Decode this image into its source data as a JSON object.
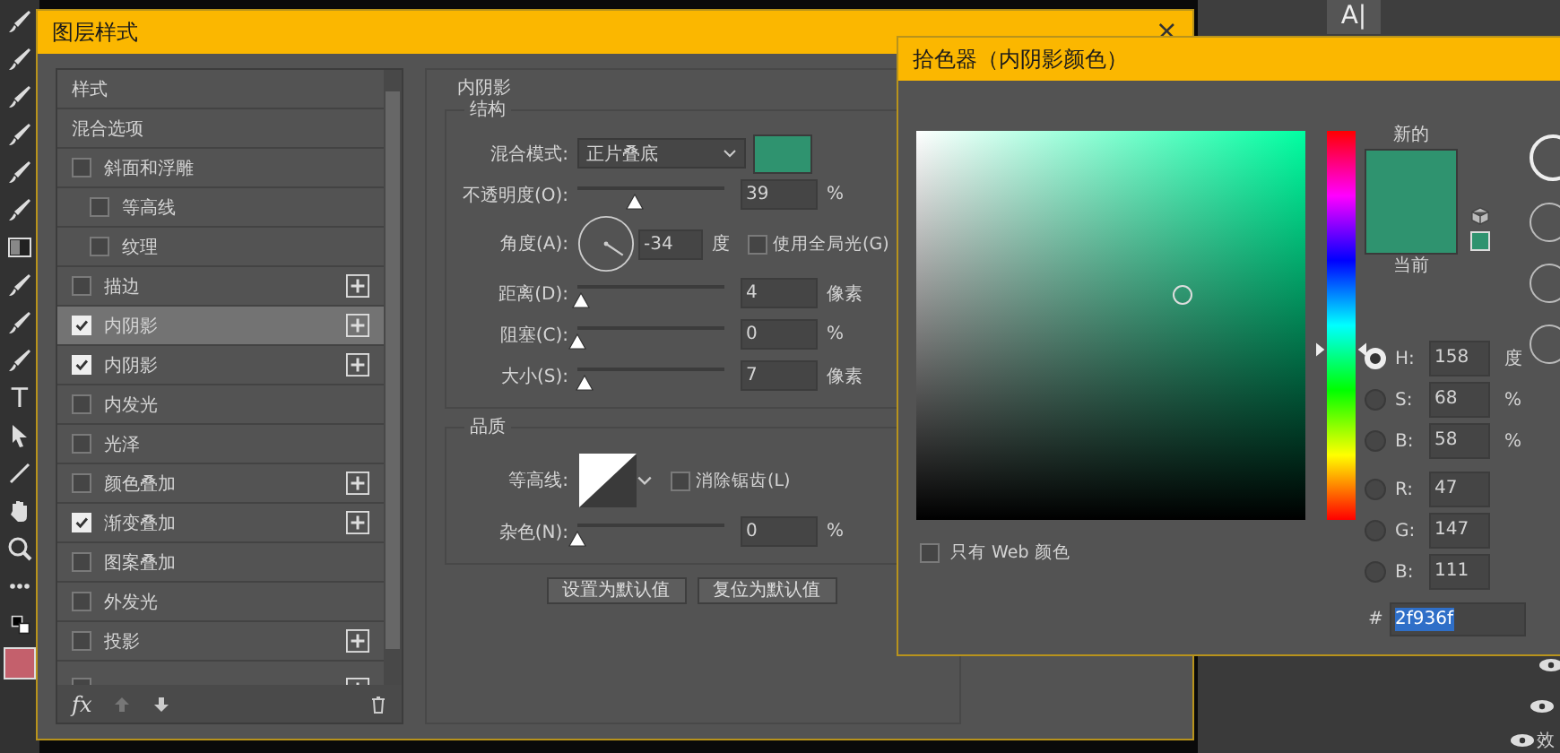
{
  "toolbar": {
    "type_tool": "T"
  },
  "background_panel": {
    "tool_glyph": "A|",
    "layer_label": "效"
  },
  "layer_style": {
    "title": "图层样式",
    "close": "×",
    "styles": [
      {
        "label": "样式",
        "kind": "header",
        "selected": false
      },
      {
        "label": "混合选项",
        "kind": "header",
        "selected": false
      },
      {
        "label": "斜面和浮雕",
        "kind": "effect",
        "checked": false,
        "addable": false,
        "selected": false,
        "children": [
          {
            "label": "等高线",
            "kind": "effect",
            "checked": false,
            "addable": false,
            "selected": false
          },
          {
            "label": "纹理",
            "kind": "effect",
            "checked": false,
            "addable": false,
            "selected": false
          }
        ]
      },
      {
        "label": "描边",
        "kind": "effect",
        "checked": false,
        "addable": true,
        "selected": false
      },
      {
        "label": "内阴影",
        "kind": "effect",
        "checked": true,
        "addable": true,
        "selected": true
      },
      {
        "label": "内阴影",
        "kind": "effect",
        "checked": true,
        "addable": true,
        "selected": false
      },
      {
        "label": "内发光",
        "kind": "effect",
        "checked": false,
        "addable": false,
        "selected": false
      },
      {
        "label": "光泽",
        "kind": "effect",
        "checked": false,
        "addable": false,
        "selected": false
      },
      {
        "label": "颜色叠加",
        "kind": "effect",
        "checked": false,
        "addable": true,
        "selected": false
      },
      {
        "label": "渐变叠加",
        "kind": "effect",
        "checked": true,
        "addable": true,
        "selected": false
      },
      {
        "label": "图案叠加",
        "kind": "effect",
        "checked": false,
        "addable": false,
        "selected": false
      },
      {
        "label": "外发光",
        "kind": "effect",
        "checked": false,
        "addable": false,
        "selected": false
      },
      {
        "label": "投影",
        "kind": "effect",
        "checked": false,
        "addable": true,
        "selected": false
      }
    ],
    "fx": "fx",
    "panel": {
      "title": "内阴影",
      "groups": [
        {
          "title": "结构",
          "rows": [
            {
              "kind": "select",
              "label": "混合模式:",
              "value": "正片叠底",
              "color": "#2f936f"
            },
            {
              "kind": "slider",
              "label": "不透明度(O):",
              "level": 0.39,
              "value": "39",
              "unit": "%"
            },
            {
              "kind": "angle",
              "label": "角度(A):",
              "value": "-34",
              "unit": "度",
              "checkbox": {
                "label": "使用全局光(G)",
                "checked": false
              }
            },
            {
              "kind": "slider",
              "label": "距离(D):",
              "level": 0.03,
              "value": "4",
              "unit": "像素"
            },
            {
              "kind": "slider",
              "label": "阻塞(C):",
              "level": 0,
              "value": "0",
              "unit": "%"
            },
            {
              "kind": "slider",
              "label": "大小(S):",
              "level": 0.05,
              "value": "7",
              "unit": "像素"
            }
          ]
        },
        {
          "title": "品质",
          "rows": [
            {
              "kind": "contour",
              "label": "等高线:",
              "checkbox": {
                "label": "消除锯齿(L)",
                "checked": false
              }
            },
            {
              "kind": "slider",
              "label": "杂色(N):",
              "level": 0,
              "value": "0",
              "unit": "%"
            }
          ]
        }
      ],
      "buttons": [
        "设置为默认值",
        "复位为默认值"
      ]
    }
  },
  "color_picker": {
    "title": "拾色器（内阴影颜色）",
    "new_label": "新的",
    "current_label": "当前",
    "fields": [
      {
        "label": "H:",
        "value": "158",
        "unit": "度",
        "selected": true
      },
      {
        "label": "S:",
        "value": "68",
        "unit": "%",
        "selected": false
      },
      {
        "label": "B:",
        "value": "58",
        "unit": "%",
        "selected": false
      },
      {
        "label": "R:",
        "value": "47",
        "selected": false
      },
      {
        "label": "G:",
        "value": "147",
        "selected": false
      },
      {
        "label": "B:",
        "value": "111",
        "selected": false
      }
    ],
    "hex": {
      "label": "#",
      "value": "2f936f"
    },
    "web_only": {
      "label": "只有 Web 颜色",
      "checked": false
    }
  }
}
